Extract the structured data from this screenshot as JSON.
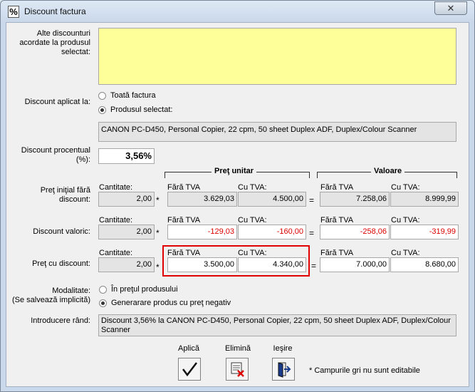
{
  "window": {
    "title": "Discount factura",
    "icon": "percent-icon",
    "close_glyph": "✕"
  },
  "other_discounts": {
    "label": "Alte discounturi acordate la produsul selectat:",
    "value": ""
  },
  "applied_to": {
    "label": "Discount aplicat la:",
    "options": [
      "Toată factura",
      "Produsul selectat:"
    ],
    "selected": 1
  },
  "product": {
    "value": "CANON PC-D450, Personal Copier, 22 cpm, 50 sheet Duplex ADF, Duplex/Colour Scanner"
  },
  "percent": {
    "label": "Discount procentual (%):",
    "value": "3,56%"
  },
  "groups": {
    "unit_price": "Preţ unitar",
    "value": "Valoare"
  },
  "col_labels": {
    "quantity": "Cantitate:",
    "no_vat": "Fără TVA",
    "with_vat": "Cu TVA:",
    "multiply": "*",
    "equals": "="
  },
  "rows": [
    {
      "label": "Preţ iniţial fără discount:",
      "quantity": "2,00",
      "unit_no_vat": "3.629,03",
      "unit_with_vat": "4.500,00",
      "val_no_vat": "7.258,06",
      "val_with_vat": "8.999,99"
    },
    {
      "label": "Discount valoric:",
      "quantity": "2,00",
      "unit_no_vat": "-129,03",
      "unit_with_vat": "-160,00",
      "val_no_vat": "-258,06",
      "val_with_vat": "-319,99"
    },
    {
      "label": "Preţ cu discount:",
      "quantity": "2,00",
      "unit_no_vat": "3.500,00",
      "unit_with_vat": "4.340,00",
      "val_no_vat": "7.000,00",
      "val_with_vat": "8.680,00"
    }
  ],
  "mode": {
    "label": "Modalitate:",
    "sublabel": "(Se salvează implicită)",
    "options": [
      "În preţul produsului",
      "Generarare produs cu preţ negativ"
    ],
    "selected": 1
  },
  "line_intro": {
    "label": "Introducere rând:",
    "value": "Discount 3,56% la CANON PC-D450, Personal Copier, 22 cpm, 50 sheet Duplex ADF, Duplex/Colour Scanner"
  },
  "buttons": {
    "apply": {
      "label": "Aplică",
      "icon": "checkmark-icon"
    },
    "delete": {
      "label": "Elimină",
      "icon": "delete-icon"
    },
    "exit": {
      "label": "Ieşire",
      "icon": "exit-door-icon"
    }
  },
  "note": "* Campurile gri nu sunt editabile",
  "colors": {
    "yellow_field": "#ffff99",
    "negative": "#dd0000",
    "highlight_border": "#e00000"
  }
}
